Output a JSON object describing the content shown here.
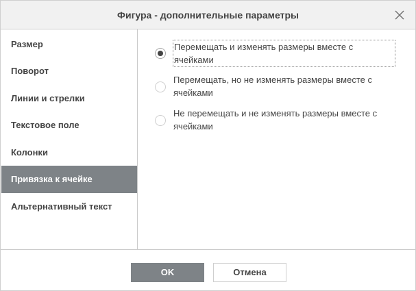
{
  "dialog": {
    "title": "Фигура - дополнительные параметры",
    "close_icon": "close-icon"
  },
  "sidebar": {
    "items": [
      {
        "label": "Размер",
        "active": false
      },
      {
        "label": "Поворот",
        "active": false
      },
      {
        "label": "Линии и стрелки",
        "active": false
      },
      {
        "label": "Текстовое поле",
        "active": false
      },
      {
        "label": "Колонки",
        "active": false
      },
      {
        "label": "Привязка к ячейке",
        "active": true
      },
      {
        "label": "Альтернативный текст",
        "active": false
      }
    ]
  },
  "content": {
    "options": [
      {
        "line1": "Перемещать и изменять размеры вместе с",
        "line2": "ячейками",
        "checked": true
      },
      {
        "line1": "Перемещать, но не изменять размеры вместе с",
        "line2": "ячейками",
        "checked": false
      },
      {
        "line1": "Не перемещать и не изменять размеры вместе с",
        "line2": "ячейками",
        "checked": false
      }
    ]
  },
  "footer": {
    "ok_label": "OK",
    "cancel_label": "Отмена"
  },
  "colors": {
    "active_bg": "#7e8387",
    "header_bg": "#f1f1f1",
    "text": "#444444"
  }
}
